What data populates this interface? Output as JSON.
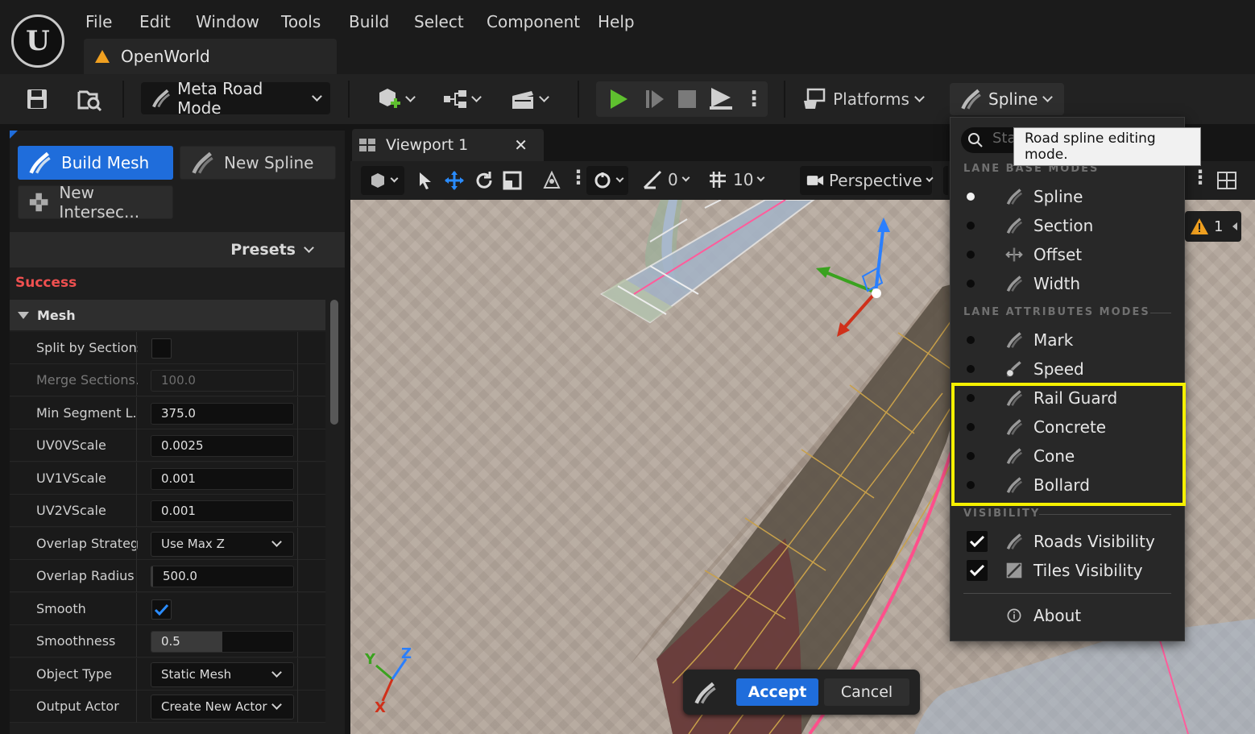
{
  "menu": {
    "items": [
      "File",
      "Edit",
      "Window",
      "Tools",
      "Build",
      "Select",
      "Component",
      "Help"
    ]
  },
  "project": {
    "name": "OpenWorld"
  },
  "toolbar": {
    "mode_label": "Meta Road Mode",
    "platforms_label": "Platforms",
    "spline_label": "Spline"
  },
  "tools": {
    "build_mesh": "Build Mesh",
    "new_spline": "New Spline",
    "new_intersection": "New Intersec..."
  },
  "presets": {
    "label": "Presets"
  },
  "status": {
    "text": "Success",
    "color": "#f05050"
  },
  "mesh": {
    "header": "Mesh",
    "properties": [
      {
        "label": "Split by Sections",
        "type": "checkbox",
        "checked": false
      },
      {
        "label": "Merge Sections...",
        "type": "number",
        "value": "100.0",
        "disabled": true
      },
      {
        "label": "Min Segment L...",
        "type": "number",
        "value": "375.0"
      },
      {
        "label": "UV0VScale",
        "type": "number",
        "value": "0.0025"
      },
      {
        "label": "UV1VScale",
        "type": "number",
        "value": "0.001"
      },
      {
        "label": "UV2VScale",
        "type": "number",
        "value": "0.001"
      },
      {
        "label": "Overlap Strategy",
        "type": "select",
        "value": "Use Max Z"
      },
      {
        "label": "Overlap Radius",
        "type": "number",
        "value": "500.0"
      },
      {
        "label": "Smooth",
        "type": "checkbox",
        "checked": true
      },
      {
        "label": "Smoothness",
        "type": "slider",
        "value": "0.5",
        "fill": 0.5
      },
      {
        "label": "Object Type",
        "type": "select",
        "value": "Static Mesh"
      },
      {
        "label": "Output Actor",
        "type": "select",
        "value": "Create New Actor"
      }
    ]
  },
  "viewport": {
    "tab_title": "Viewport 1",
    "rotation_snap": "0",
    "grid_snap": "10",
    "view_mode": "Perspective",
    "warning_count": "1",
    "axes": {
      "x": "X",
      "y": "Y",
      "z": "Z"
    }
  },
  "accept_bar": {
    "accept": "Accept",
    "cancel": "Cancel"
  },
  "dropdown": {
    "search_placeholder": "Sta",
    "tooltip": "Road spline editing mode.",
    "sections": {
      "lane_base": "LANE BASE MODES",
      "lane_attributes": "LANE ATTRIBUTES MODES",
      "visibility": "VISIBILITY"
    },
    "lane_base_items": [
      {
        "label": "Spline",
        "active": true
      },
      {
        "label": "Section",
        "active": false
      },
      {
        "label": "Offset",
        "active": false
      },
      {
        "label": "Width",
        "active": false
      }
    ],
    "lane_attr_items": [
      {
        "label": "Mark",
        "active": false
      },
      {
        "label": "Speed",
        "active": false
      },
      {
        "label": "Rail Guard",
        "active": false
      },
      {
        "label": "Concrete",
        "active": false
      },
      {
        "label": "Cone",
        "active": false
      },
      {
        "label": "Bollard",
        "active": false
      }
    ],
    "visibility_items": [
      {
        "label": "Roads Visibility",
        "checked": true
      },
      {
        "label": "Tiles Visibility",
        "checked": true
      }
    ],
    "about": "About"
  },
  "colors": {
    "accent": "#1f6ddb",
    "highlight": "#f5f000",
    "play": "#5fc02f",
    "road_line": "#ff4f8b"
  }
}
